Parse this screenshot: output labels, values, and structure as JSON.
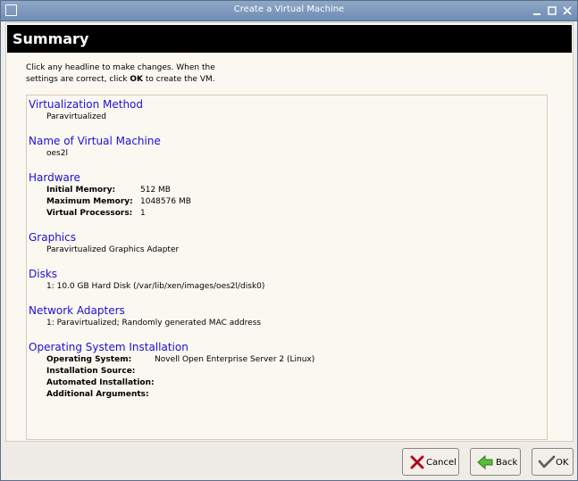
{
  "window": {
    "title": "Create a Virtual Machine"
  },
  "header": {
    "title": "Summary"
  },
  "intro": {
    "line1": "Click any headline to make changes.  When the",
    "line2_pre": "settings are correct, click ",
    "line2_bold": "OK",
    "line2_post": " to create the VM."
  },
  "sections": {
    "virtualization": {
      "heading": "Virtualization Method",
      "value": "Paravirtualized"
    },
    "name": {
      "heading": "Name of Virtual Machine",
      "value": "oes2l"
    },
    "hardware": {
      "heading": "Hardware",
      "rows": [
        {
          "label": "Initial Memory:",
          "value": "512 MB"
        },
        {
          "label": "Maximum Memory:",
          "value": "1048576 MB"
        },
        {
          "label": "Virtual Processors:",
          "value": "1"
        }
      ]
    },
    "graphics": {
      "heading": "Graphics",
      "value": "Paravirtualized Graphics Adapter"
    },
    "disks": {
      "heading": "Disks",
      "value": "1: 10.0 GB Hard Disk (/var/lib/xen/images/oes2l/disk0)"
    },
    "network": {
      "heading": "Network Adapters",
      "value": "1: Paravirtualized; Randomly generated MAC address"
    },
    "os": {
      "heading": "Operating System Installation",
      "rows": [
        {
          "label": "Operating System:",
          "value": "Novell Open Enterprise Server 2 (Linux)"
        },
        {
          "label": "Installation Source:",
          "value": ""
        },
        {
          "label": "Automated Installation:",
          "value": ""
        },
        {
          "label": "Additional Arguments:",
          "value": ""
        }
      ]
    }
  },
  "buttons": {
    "cancel": "Cancel",
    "back": "Back",
    "ok": "OK"
  },
  "icons": {
    "cancel": "x-icon",
    "back": "back-arrow-icon",
    "ok": "ok-check-icon"
  }
}
